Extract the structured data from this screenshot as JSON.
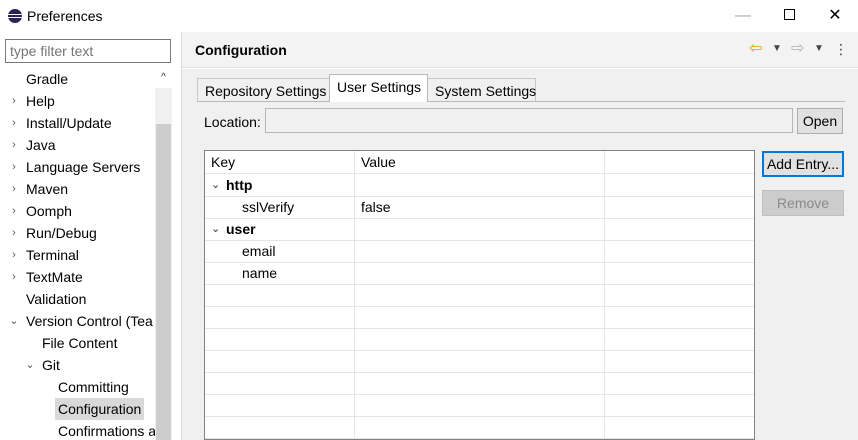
{
  "window": {
    "title": "Preferences",
    "minimize_glyph": "—",
    "close_glyph": "✕"
  },
  "filter": {
    "placeholder": "type filter text"
  },
  "tree": [
    {
      "label": "Gradle",
      "level": 0,
      "expander": ""
    },
    {
      "label": "Help",
      "level": 0,
      "expander": "›"
    },
    {
      "label": "Install/Update",
      "level": 0,
      "expander": "›"
    },
    {
      "label": "Java",
      "level": 0,
      "expander": "›"
    },
    {
      "label": "Language Servers",
      "level": 0,
      "expander": "›"
    },
    {
      "label": "Maven",
      "level": 0,
      "expander": "›"
    },
    {
      "label": "Oomph",
      "level": 0,
      "expander": "›"
    },
    {
      "label": "Run/Debug",
      "level": 0,
      "expander": "›"
    },
    {
      "label": "Terminal",
      "level": 0,
      "expander": "›"
    },
    {
      "label": "TextMate",
      "level": 0,
      "expander": "›"
    },
    {
      "label": "Validation",
      "level": 0,
      "expander": ""
    },
    {
      "label": "Version Control (Tea",
      "level": 0,
      "expander": "⌄"
    },
    {
      "label": "File Content",
      "level": 1,
      "expander": ""
    },
    {
      "label": "Git",
      "level": 1,
      "expander": "⌄"
    },
    {
      "label": "Committing",
      "level": 2,
      "expander": ""
    },
    {
      "label": "Configuration",
      "level": 2,
      "expander": "",
      "selected": true
    },
    {
      "label": "Confirmations a",
      "level": 2,
      "expander": ""
    }
  ],
  "page": {
    "title": "Configuration",
    "tabs": [
      {
        "label": "Repository Settings"
      },
      {
        "label": "User Settings",
        "active": true
      },
      {
        "label": "System Settings"
      }
    ],
    "location_label": "Location:",
    "location_value": "",
    "open_button": "Open",
    "add_entry_button": "Add Entry...",
    "remove_button": "Remove"
  },
  "table": {
    "columns": [
      "Key",
      "Value",
      ""
    ],
    "rows": [
      {
        "type": "group",
        "key": "http",
        "value": ""
      },
      {
        "type": "entry",
        "key": "sslVerify",
        "value": "false"
      },
      {
        "type": "group",
        "key": "user",
        "value": ""
      },
      {
        "type": "entry",
        "key": "email",
        "value": ""
      },
      {
        "type": "entry",
        "key": "name",
        "value": ""
      }
    ],
    "empty_rows": 7
  },
  "colors": {
    "selection": "#d9d9d9",
    "focus_border": "#0078d7",
    "nav_back": "#e0a000"
  }
}
